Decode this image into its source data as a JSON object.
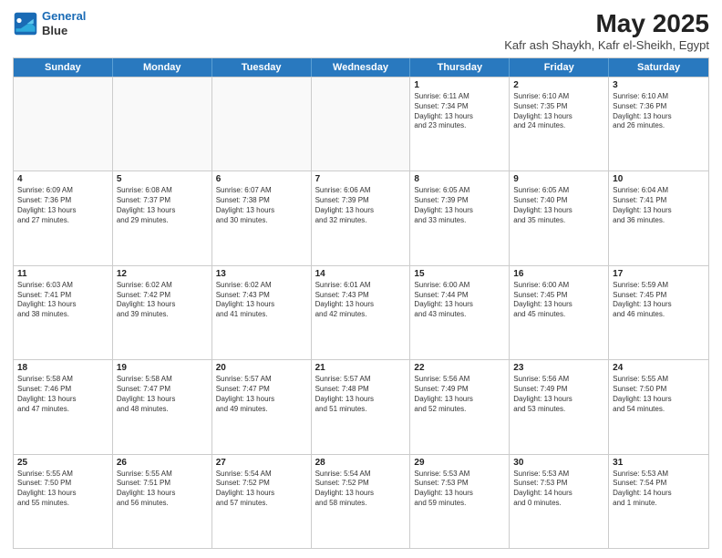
{
  "logo": {
    "line1": "General",
    "line2": "Blue"
  },
  "title": "May 2025",
  "location": "Kafr ash Shaykh, Kafr el-Sheikh, Egypt",
  "header": {
    "days": [
      "Sunday",
      "Monday",
      "Tuesday",
      "Wednesday",
      "Thursday",
      "Friday",
      "Saturday"
    ]
  },
  "rows": [
    [
      {
        "day": "",
        "info": ""
      },
      {
        "day": "",
        "info": ""
      },
      {
        "day": "",
        "info": ""
      },
      {
        "day": "",
        "info": ""
      },
      {
        "day": "1",
        "info": "Sunrise: 6:11 AM\nSunset: 7:34 PM\nDaylight: 13 hours\nand 23 minutes."
      },
      {
        "day": "2",
        "info": "Sunrise: 6:10 AM\nSunset: 7:35 PM\nDaylight: 13 hours\nand 24 minutes."
      },
      {
        "day": "3",
        "info": "Sunrise: 6:10 AM\nSunset: 7:36 PM\nDaylight: 13 hours\nand 26 minutes."
      }
    ],
    [
      {
        "day": "4",
        "info": "Sunrise: 6:09 AM\nSunset: 7:36 PM\nDaylight: 13 hours\nand 27 minutes."
      },
      {
        "day": "5",
        "info": "Sunrise: 6:08 AM\nSunset: 7:37 PM\nDaylight: 13 hours\nand 29 minutes."
      },
      {
        "day": "6",
        "info": "Sunrise: 6:07 AM\nSunset: 7:38 PM\nDaylight: 13 hours\nand 30 minutes."
      },
      {
        "day": "7",
        "info": "Sunrise: 6:06 AM\nSunset: 7:39 PM\nDaylight: 13 hours\nand 32 minutes."
      },
      {
        "day": "8",
        "info": "Sunrise: 6:05 AM\nSunset: 7:39 PM\nDaylight: 13 hours\nand 33 minutes."
      },
      {
        "day": "9",
        "info": "Sunrise: 6:05 AM\nSunset: 7:40 PM\nDaylight: 13 hours\nand 35 minutes."
      },
      {
        "day": "10",
        "info": "Sunrise: 6:04 AM\nSunset: 7:41 PM\nDaylight: 13 hours\nand 36 minutes."
      }
    ],
    [
      {
        "day": "11",
        "info": "Sunrise: 6:03 AM\nSunset: 7:41 PM\nDaylight: 13 hours\nand 38 minutes."
      },
      {
        "day": "12",
        "info": "Sunrise: 6:02 AM\nSunset: 7:42 PM\nDaylight: 13 hours\nand 39 minutes."
      },
      {
        "day": "13",
        "info": "Sunrise: 6:02 AM\nSunset: 7:43 PM\nDaylight: 13 hours\nand 41 minutes."
      },
      {
        "day": "14",
        "info": "Sunrise: 6:01 AM\nSunset: 7:43 PM\nDaylight: 13 hours\nand 42 minutes."
      },
      {
        "day": "15",
        "info": "Sunrise: 6:00 AM\nSunset: 7:44 PM\nDaylight: 13 hours\nand 43 minutes."
      },
      {
        "day": "16",
        "info": "Sunrise: 6:00 AM\nSunset: 7:45 PM\nDaylight: 13 hours\nand 45 minutes."
      },
      {
        "day": "17",
        "info": "Sunrise: 5:59 AM\nSunset: 7:45 PM\nDaylight: 13 hours\nand 46 minutes."
      }
    ],
    [
      {
        "day": "18",
        "info": "Sunrise: 5:58 AM\nSunset: 7:46 PM\nDaylight: 13 hours\nand 47 minutes."
      },
      {
        "day": "19",
        "info": "Sunrise: 5:58 AM\nSunset: 7:47 PM\nDaylight: 13 hours\nand 48 minutes."
      },
      {
        "day": "20",
        "info": "Sunrise: 5:57 AM\nSunset: 7:47 PM\nDaylight: 13 hours\nand 49 minutes."
      },
      {
        "day": "21",
        "info": "Sunrise: 5:57 AM\nSunset: 7:48 PM\nDaylight: 13 hours\nand 51 minutes."
      },
      {
        "day": "22",
        "info": "Sunrise: 5:56 AM\nSunset: 7:49 PM\nDaylight: 13 hours\nand 52 minutes."
      },
      {
        "day": "23",
        "info": "Sunrise: 5:56 AM\nSunset: 7:49 PM\nDaylight: 13 hours\nand 53 minutes."
      },
      {
        "day": "24",
        "info": "Sunrise: 5:55 AM\nSunset: 7:50 PM\nDaylight: 13 hours\nand 54 minutes."
      }
    ],
    [
      {
        "day": "25",
        "info": "Sunrise: 5:55 AM\nSunset: 7:50 PM\nDaylight: 13 hours\nand 55 minutes."
      },
      {
        "day": "26",
        "info": "Sunrise: 5:55 AM\nSunset: 7:51 PM\nDaylight: 13 hours\nand 56 minutes."
      },
      {
        "day": "27",
        "info": "Sunrise: 5:54 AM\nSunset: 7:52 PM\nDaylight: 13 hours\nand 57 minutes."
      },
      {
        "day": "28",
        "info": "Sunrise: 5:54 AM\nSunset: 7:52 PM\nDaylight: 13 hours\nand 58 minutes."
      },
      {
        "day": "29",
        "info": "Sunrise: 5:53 AM\nSunset: 7:53 PM\nDaylight: 13 hours\nand 59 minutes."
      },
      {
        "day": "30",
        "info": "Sunrise: 5:53 AM\nSunset: 7:53 PM\nDaylight: 14 hours\nand 0 minutes."
      },
      {
        "day": "31",
        "info": "Sunrise: 5:53 AM\nSunset: 7:54 PM\nDaylight: 14 hours\nand 1 minute."
      }
    ]
  ]
}
